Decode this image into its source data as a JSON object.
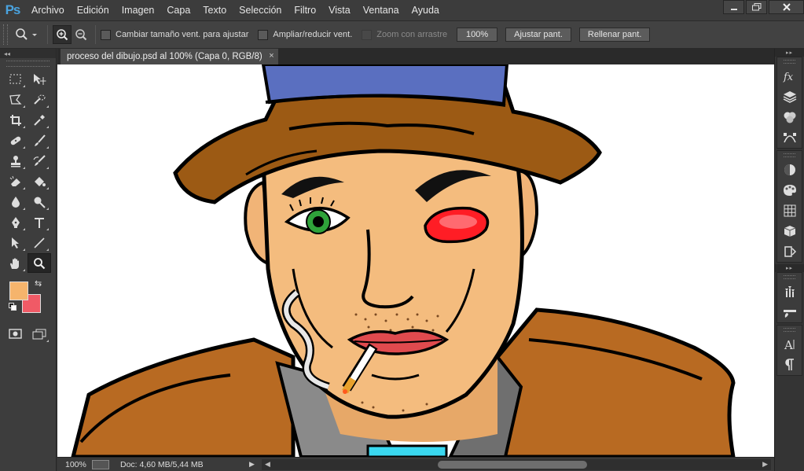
{
  "app": {
    "logo": "Ps",
    "menu": [
      "Archivo",
      "Edición",
      "Imagen",
      "Capa",
      "Texto",
      "Selección",
      "Filtro",
      "Vista",
      "Ventana",
      "Ayuda"
    ]
  },
  "options": {
    "resize_windows": "Cambiar tamaño vent. para ajustar",
    "zoom_all_windows": "Ampliar/reducir vent.",
    "scrubby_zoom": "Zoom con arrastre",
    "zoom_value": "100%",
    "fit_screen": "Ajustar pant.",
    "fill_screen": "Rellenar pant."
  },
  "document": {
    "tab_title": "proceso del dibujo.psd al 100% (Capa 0, RGB/8)",
    "close_glyph": "×"
  },
  "colors": {
    "foreground": "#f5b46c",
    "background": "#f05a66",
    "accent": "#4aa3df"
  },
  "status": {
    "zoom": "100%",
    "doc_info": "Doc: 4,60 MB/5,44 MB"
  },
  "tools_panel": {
    "collapse_glyph": "◂◂"
  },
  "dock": {
    "collapse_glyph": "▸▸"
  }
}
